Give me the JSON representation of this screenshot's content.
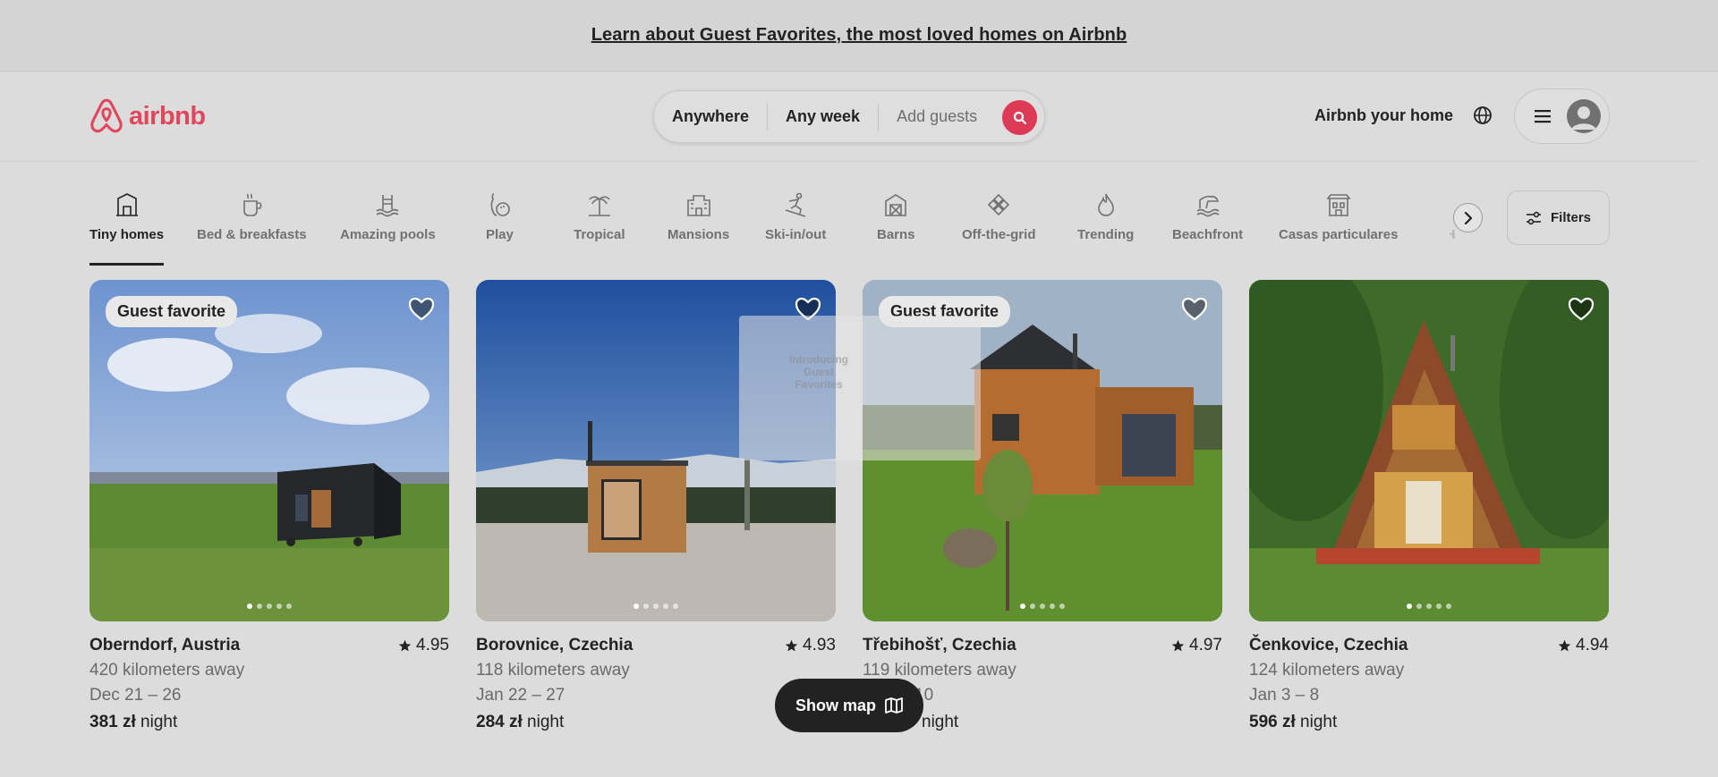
{
  "announcement": {
    "text": "Learn about Guest Favorites, the most loved homes on Airbnb"
  },
  "header": {
    "logo_text": "airbnb",
    "search": {
      "where": "Anywhere",
      "when": "Any week",
      "guests": "Add guests"
    },
    "host_link": "Airbnb your home"
  },
  "categories": [
    {
      "label": "Tiny homes",
      "icon": "tiny-home-icon",
      "active": true
    },
    {
      "label": "Bed & breakfasts",
      "icon": "coffee-icon"
    },
    {
      "label": "Amazing pools",
      "icon": "pool-icon"
    },
    {
      "label": "Play",
      "icon": "bowling-icon"
    },
    {
      "label": "Tropical",
      "icon": "palm-tree-icon"
    },
    {
      "label": "Mansions",
      "icon": "mansion-icon"
    },
    {
      "label": "Ski-in/out",
      "icon": "skier-icon"
    },
    {
      "label": "Barns",
      "icon": "barn-icon"
    },
    {
      "label": "Off-the-grid",
      "icon": "off-grid-icon"
    },
    {
      "label": "Trending",
      "icon": "flame-icon"
    },
    {
      "label": "Beachfront",
      "icon": "beach-icon"
    },
    {
      "label": "Casas particulares",
      "icon": "casa-icon"
    },
    {
      "label": "H",
      "icon": "partial-icon"
    }
  ],
  "filters_label": "Filters",
  "listings": [
    {
      "badge": "Guest favorite",
      "title": "Oberndorf, Austria",
      "rating": "4.95",
      "distance": "420 kilometers away",
      "dates": "Dec 21 – 26",
      "price": "381 zł",
      "price_unit": "night"
    },
    {
      "badge": "",
      "title": "Borovnice, Czechia",
      "rating": "4.93",
      "distance": "118 kilometers away",
      "dates": "Jan 22 – 27",
      "price": "284 zł",
      "price_unit": "night"
    },
    {
      "badge": "Guest favorite",
      "title": "Třebihošť, Czechia",
      "rating": "4.97",
      "distance": "119 kilometers away",
      "dates": "10",
      "price": "",
      "price_unit": "night"
    },
    {
      "badge": "",
      "title": "Čenkovice, Czechia",
      "rating": "4.94",
      "distance": "124 kilometers away",
      "dates": "Jan 3 – 8",
      "price": "596 zł",
      "price_unit": "night"
    }
  ],
  "overlay_ghost": {
    "text": "Introducing Guest Favorites"
  },
  "show_map_label": "Show map"
}
